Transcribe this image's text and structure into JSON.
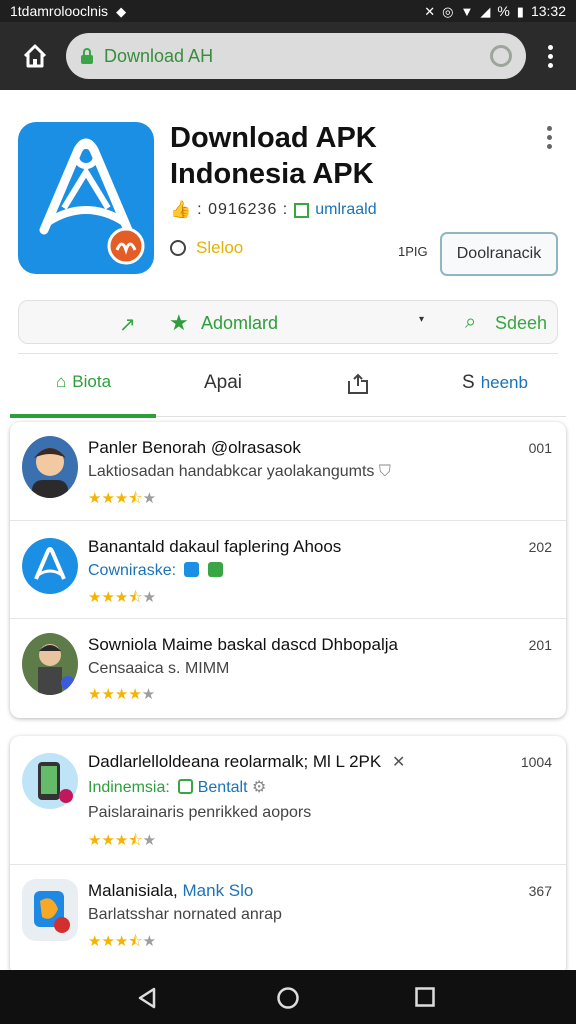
{
  "status_bar": {
    "left_text": "1tdamrolooclnis",
    "battery_text": "%",
    "time": "13:32"
  },
  "browser": {
    "url": "Download AH"
  },
  "app": {
    "title": "Download APK Indonesia APK",
    "meta_code": ": 0916236 :",
    "meta_link": "umlraald",
    "size_label": "Sleloo",
    "version": "1PIG",
    "download_button": "Doolranacik"
  },
  "action_bar": {
    "primary_label": "Adomlard",
    "search_label": "Sdeeh"
  },
  "tabs": [
    {
      "label": "Biota"
    },
    {
      "label": "Apai"
    },
    {
      "label": ""
    },
    {
      "label_prefix": "S",
      "label": "heenb"
    }
  ],
  "list_card_1": [
    {
      "title": "Panler Benorah @olrasasok",
      "subtitle": "Laktiosadan handabkcar yaolakangumts",
      "count": "001",
      "rating": 3.5
    },
    {
      "title": "Banantald dakaul faplering Ahoos",
      "subtitle": "Cowniraske:",
      "count": "202",
      "rating": 3.5
    },
    {
      "title": "Sowniola Maime baskal dascd Dhbopalja",
      "subtitle": "Censaaica s. MIMM",
      "count": "201",
      "rating": 4
    }
  ],
  "list_card_2": [
    {
      "title": "Dadlarlelloldeana reolarmalk; Ml L 2PK",
      "subtitle_green": "Indinemsia:",
      "subtitle_blue": "Bentalt",
      "subtitle2": "Paislarainaris penrikked aopors",
      "count": "1004",
      "rating": 3.5
    },
    {
      "title_black": "Malanisiala,",
      "title_blue": "Mank Slo",
      "subtitle": "Barlatsshar nornated anrap",
      "count": "367",
      "rating": 3.5
    }
  ],
  "colors": {
    "accent_green": "#2e9e3c",
    "link_blue": "#1a73b8",
    "app_icon_blue": "#1b8fe3",
    "star_yellow": "#f4b400"
  }
}
